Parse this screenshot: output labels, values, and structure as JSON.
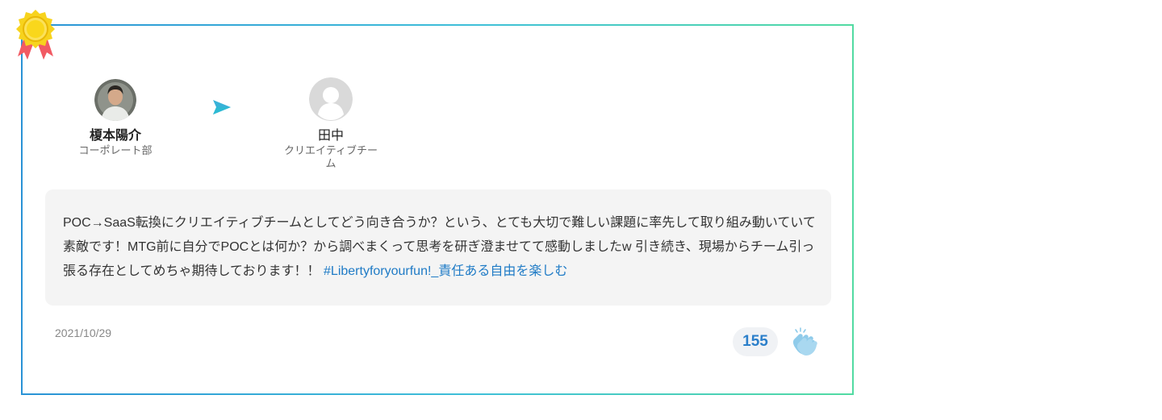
{
  "sender": {
    "name": "榎本陽介",
    "department": "コーポレート部"
  },
  "receiver": {
    "name": "田中",
    "department": "クリエイティブチーム"
  },
  "message": {
    "body": "POC→SaaS転換にクリエイティブチームとしてどう向き合うか？という、とても大切で難しい課題に率先して取り組み動いていて素敵です！MTG前に自分でPOCとは何か？から調べまくって思考を研ぎ澄ませてて感動しましたw 引き続き、現場からチーム引っ張る存在としてめちゃ期待しております！！ ",
    "hashtag": "#Libertyforyourfun!_責任ある自由を楽しむ"
  },
  "date": "2021/10/29",
  "clap_count": "155",
  "icons": {
    "badge": "award-ribbon-icon",
    "send": "send-arrow-icon",
    "clap": "clap-hands-icon",
    "receiver_avatar": "default-user-icon"
  },
  "colors": {
    "frame_gradient": [
      "#2a93d6",
      "#3fc0d8",
      "#52dba2"
    ],
    "hashtag": "#1f7bc6",
    "count": "#2b7fca",
    "badge_gold": "#f7d31d",
    "badge_ribbon": "#f15a63"
  }
}
